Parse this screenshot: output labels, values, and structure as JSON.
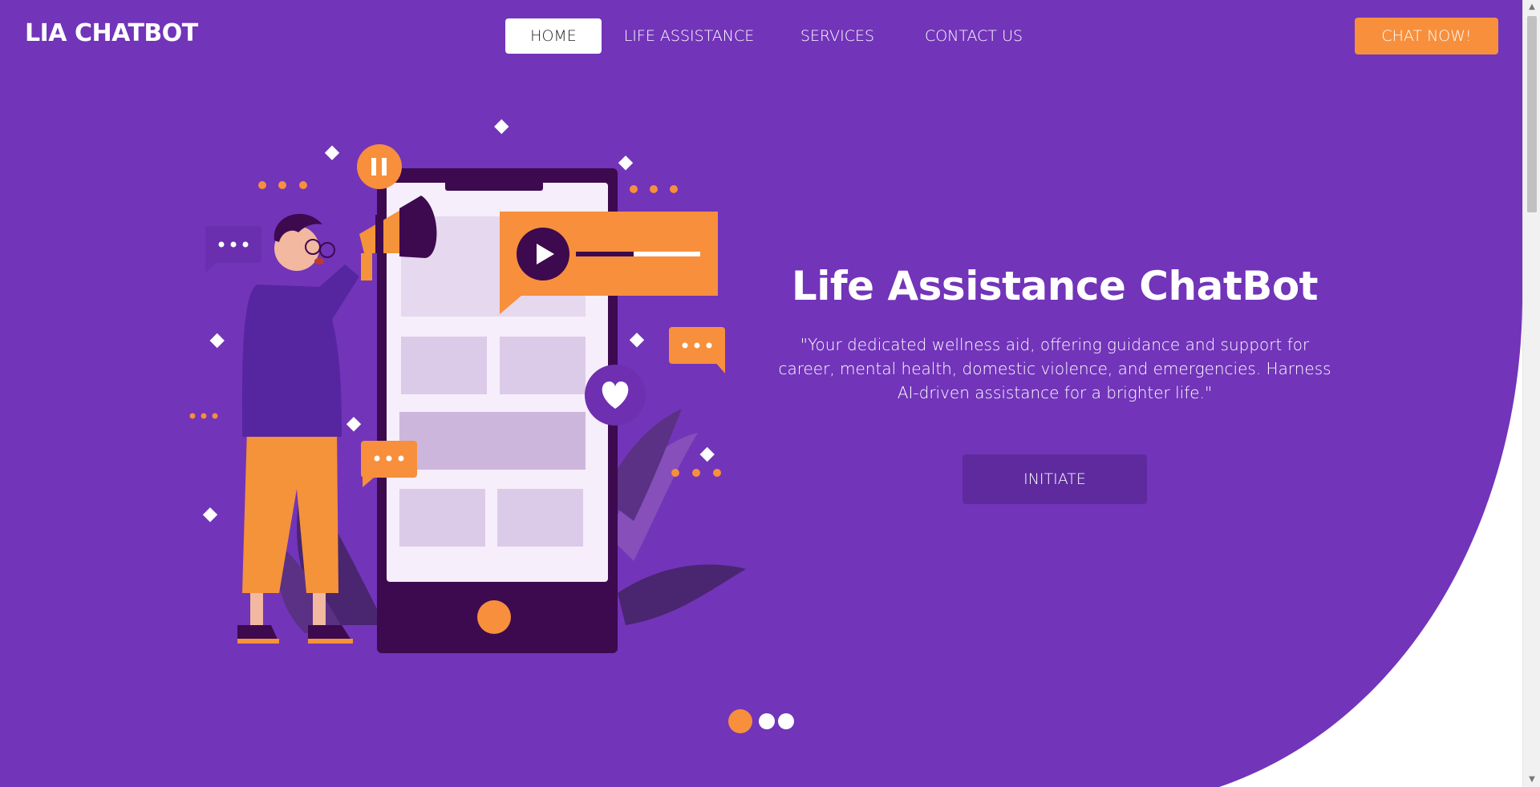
{
  "brand": "LIA CHATBOT",
  "nav": {
    "items": [
      {
        "label": "HOME",
        "active": true
      },
      {
        "label": "LIFE ASSISTANCE",
        "active": false
      },
      {
        "label": "SERVICES",
        "active": false
      },
      {
        "label": "CONTACT US",
        "active": false
      }
    ],
    "cta": "CHAT NOW!"
  },
  "hero": {
    "title": "Life Assistance ChatBot",
    "description": "\"Your dedicated wellness aid, offering guidance and support for career, mental health, domestic violence, and emergencies. Harness AI-driven assistance for a brighter life.\"",
    "button": "INITIATE"
  },
  "carousel": {
    "slide_count": 3,
    "active_index": 0
  },
  "colors": {
    "primary": "#7234b9",
    "accent": "#f78f3c",
    "dark_purple": "#5e2a9e",
    "white": "#ffffff"
  },
  "icons": [
    "pause-icon",
    "play-icon",
    "heart-icon",
    "chat-bubble-icon",
    "megaphone-icon"
  ]
}
